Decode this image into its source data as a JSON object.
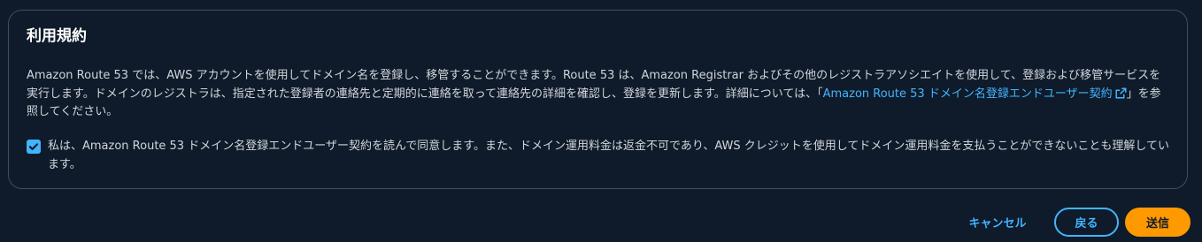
{
  "terms": {
    "title": "利用規約",
    "description_part1": "Amazon Route 53 では、AWS アカウントを使用してドメイン名を登録し、移管することができます。Route 53 は、Amazon Registrar およびその他のレジストラアソシエイトを使用して、登録および移管サービスを実行します。ドメインのレジストラは、指定された登録者の連絡先と定期的に連絡を取って連絡先の詳細を確認し、登録を更新します。詳細については、「",
    "link_label": "Amazon Route 53 ドメイン名登録エンドユーザー契約",
    "link_icon": "external-link-icon",
    "description_part2": "」を参照してください。",
    "agreement_checked": true,
    "agreement_text": "私は、Amazon Route 53 ドメイン名登録エンドユーザー契約を読んで同意します。また、ドメイン運用料金は返金不可であり、AWS クレジットを使用してドメイン運用料金を支払うことができないことも理解しています。"
  },
  "footer": {
    "cancel_label": "キャンセル",
    "back_label": "戻る",
    "submit_label": "送信"
  },
  "colors": {
    "background": "#0f1b2a",
    "border": "#414d5c",
    "accent": "#42b4ff",
    "primary_button": "#ff9900"
  }
}
